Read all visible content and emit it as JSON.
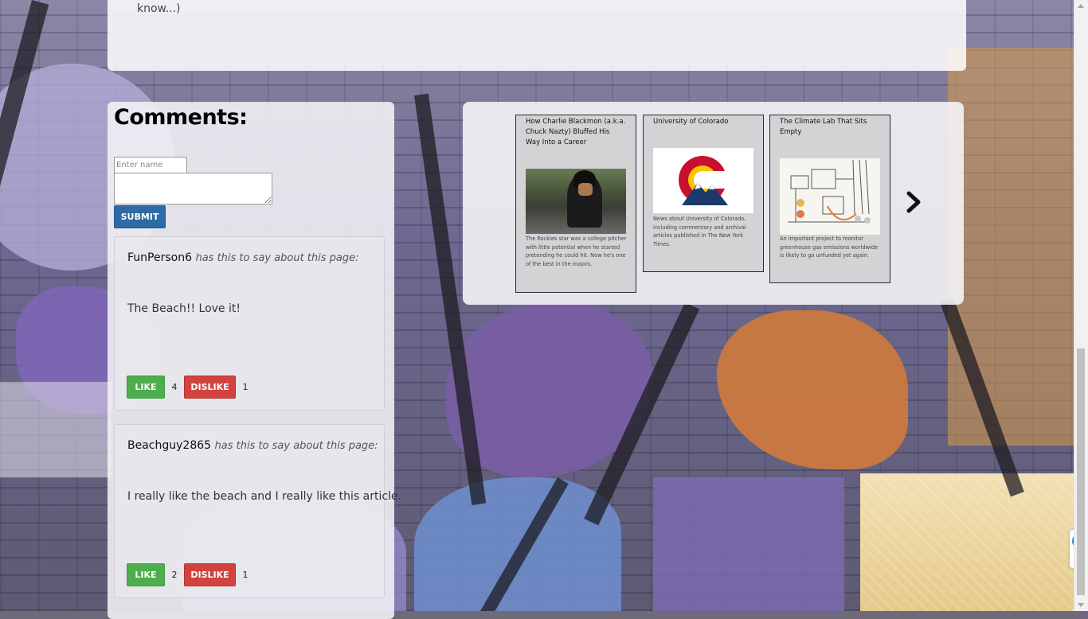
{
  "article_tail": "know...)",
  "comments": {
    "title": "Comments:",
    "name_placeholder": "Enter name",
    "submit_label": "SUBMIT",
    "items": [
      {
        "user": "FunPerson6",
        "says": "has this to say about this page:",
        "body": "The Beach!! Love it!",
        "like_label": "LIKE",
        "likes": "4",
        "dislike_label": "DISLIKE",
        "dislikes": "1"
      },
      {
        "user": "Beachguy2865",
        "says": "has this to say about this page:",
        "body": "I really like the beach and I really like this article.",
        "like_label": "LIKE",
        "likes": "2",
        "dislike_label": "DISLIKE",
        "dislikes": "1"
      }
    ]
  },
  "related": {
    "cards": [
      {
        "title": "How Charlie Blackmon (a.k.a. Chuck Nazty) Bluffed His Way Into a Career",
        "description": "The Rockies star was a college pitcher with little potential when he started pretending he could hit. Now he's one of the best in the majors."
      },
      {
        "title": "University of Colorado",
        "description": "News about University of Colorado, including commentary and archival articles published in The New York Times."
      },
      {
        "title": "The Climate Lab That Sits Empty",
        "description": "An important project to monitor greenhouse gas emissions worldwide is likely to go unfunded yet again."
      }
    ],
    "next_icon": "chevron-right-icon"
  },
  "colors": {
    "submit": "#2d6aa6",
    "like": "#4cae4c",
    "dislike": "#d2433f"
  }
}
